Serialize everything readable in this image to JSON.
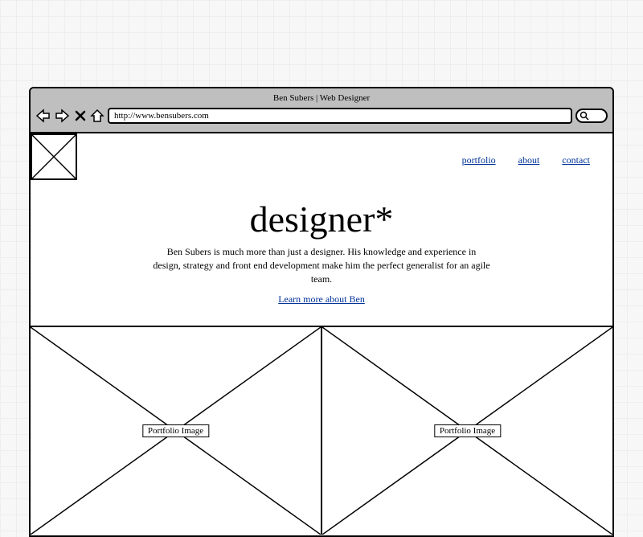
{
  "browser": {
    "title": "Ben Subers | Web Designer",
    "url": "http://www.bensubers.com"
  },
  "nav": {
    "portfolio": "portfolio",
    "about": "about",
    "contact": "contact"
  },
  "hero": {
    "heading": "designer*",
    "body": "Ben Subers is much more than just a designer. His knowledge and experience in design, strategy and front end development make him the perfect generalist for an agile team.",
    "cta": "Learn more about Ben"
  },
  "portfolio": {
    "item1_label": "Portfolio Image",
    "item2_label": "Portfolio Image"
  }
}
